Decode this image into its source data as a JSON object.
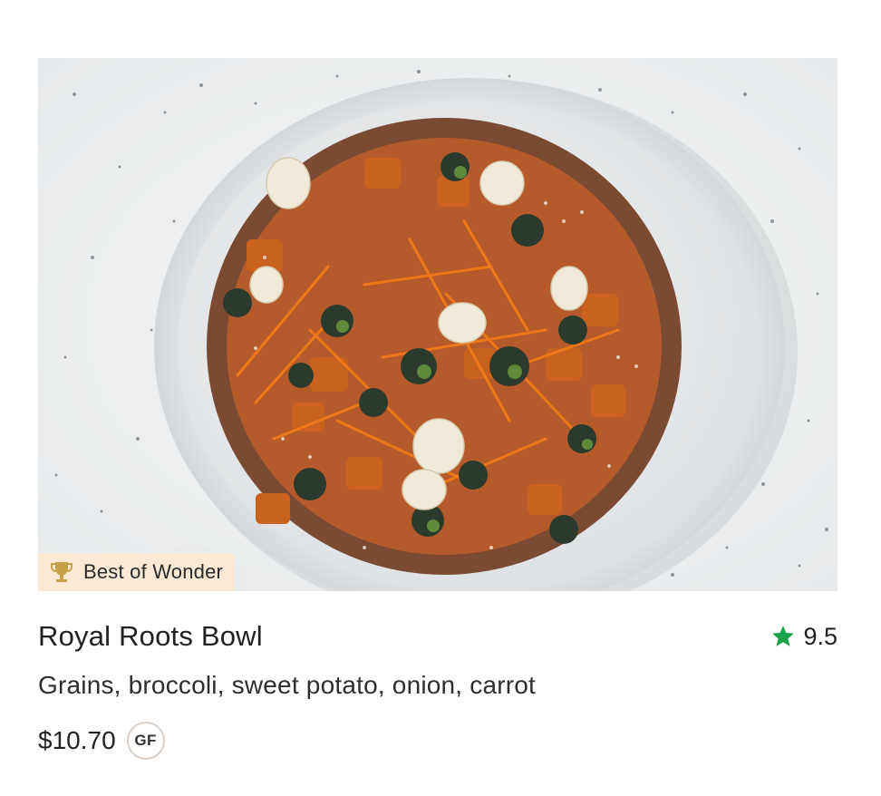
{
  "item": {
    "badge": {
      "label": "Best of Wonder",
      "icon": "trophy-icon",
      "background": "#fbe9d3"
    },
    "image_alt": "Royal Roots Bowl",
    "name": "Royal Roots Bowl",
    "rating": {
      "icon": "star-icon",
      "value": "9.5",
      "color": "#1aa34a"
    },
    "description": "Grains, broccoli, sweet potato, onion, carrot",
    "price": "$10.70",
    "dietary_tag": "GF"
  }
}
